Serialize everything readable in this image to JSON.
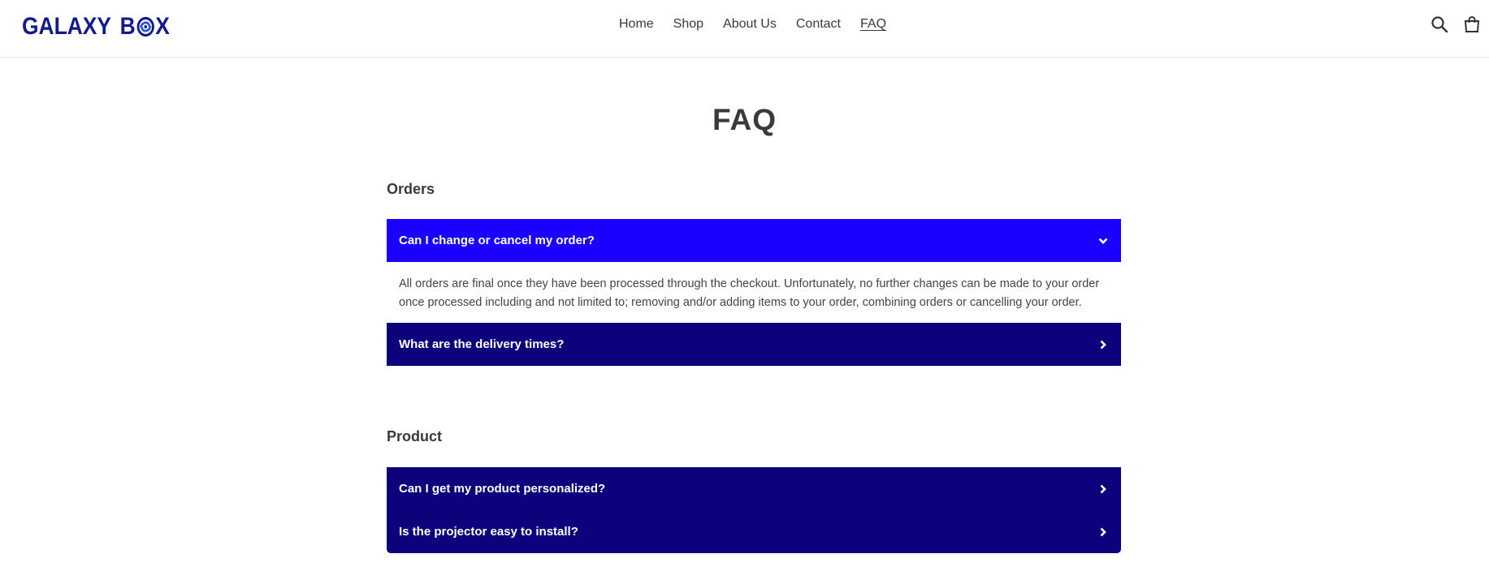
{
  "brand": {
    "name_part1": "GALAXY",
    "name_part2_b": "B",
    "name_part2_x": "X"
  },
  "nav": {
    "items": [
      {
        "label": "Home"
      },
      {
        "label": "Shop"
      },
      {
        "label": "About Us"
      },
      {
        "label": "Contact"
      },
      {
        "label": "FAQ",
        "active": true
      }
    ]
  },
  "header_icons": [
    "search-icon",
    "cart-icon"
  ],
  "page": {
    "title": "FAQ"
  },
  "sections": [
    {
      "title": "Orders",
      "questions": [
        {
          "question": "Can I change or cancel my order?",
          "expanded": true,
          "answer": "All orders are final once they have been processed through the checkout. Unfortunately, no further changes can be made to your order once processed including and not limited to; removing and/or adding items to your order, combining orders or cancelling your order."
        },
        {
          "question": "What are the delivery times?",
          "expanded": false
        }
      ]
    },
    {
      "title": "Product",
      "questions": [
        {
          "question": "Can I get my product personalized?",
          "expanded": false
        },
        {
          "question": "Is the projector easy to install?",
          "expanded": false
        }
      ]
    }
  ],
  "colors": {
    "brand": "#141a8c",
    "accordion_closed": "#0e027c",
    "accordion_open": "#1a00ff",
    "text": "#3a3a3a"
  }
}
